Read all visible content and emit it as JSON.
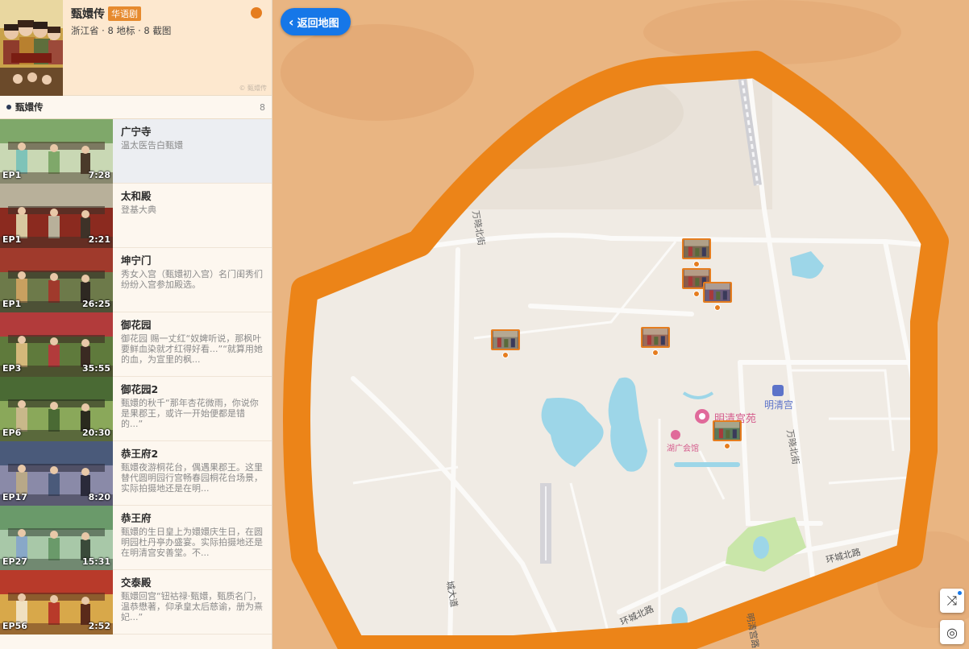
{
  "header": {
    "show_title": "甄嬛传",
    "show_tag": "华语剧",
    "meta": "浙江省 · 8 地标 · 8 截图",
    "copyright": "© 甄嬛传"
  },
  "group": {
    "name": "甄嬛传",
    "count": "8"
  },
  "items": [
    {
      "title": "广宁寺",
      "desc": "温太医告白甄嬛",
      "ep": "EP1",
      "duration": "7:28",
      "active": true
    },
    {
      "title": "太和殿",
      "desc": "登基大典",
      "ep": "EP1",
      "duration": "2:21"
    },
    {
      "title": "坤宁门",
      "desc": "秀女入宫（甄嬛初入宫）名门闺秀们纷纷入宫参加殿选。",
      "ep": "EP1",
      "duration": "26:25"
    },
    {
      "title": "御花园",
      "desc": "御花园 赐一丈红“奴婢听说，那枫叶要鲜血染就才红得好看...”“就算用她的血，为宣里的枫...",
      "ep": "EP3",
      "duration": "35:55"
    },
    {
      "title": "御花园2",
      "desc": "甄嬛的秋千“那年杏花微雨，你说你是果郡王，或许一开始便都是错的...”",
      "ep": "EP6",
      "duration": "20:30"
    },
    {
      "title": "恭王府2",
      "desc": "甄嬛夜游桐花台，偶遇果郡王。这里替代圆明园行宫畅春园桐花台场景，实际拍摄地还是在明...",
      "ep": "EP17",
      "duration": "8:20"
    },
    {
      "title": "恭王府",
      "desc": "甄嬛的生日皇上为嬛嬛庆生日，在圆明园杜丹亭办盛宴。实际拍摄地还是在明清宫安善堂。不...",
      "ep": "EP27",
      "duration": "15:31"
    },
    {
      "title": "交泰殿",
      "desc": "甄嬛回宫“钮祜禄·甄嬛，甄质名门，温恭懋著，仰承皇太后慈谕，册为熹妃...”",
      "ep": "EP56",
      "duration": "2:52"
    }
  ],
  "map": {
    "back_label": "返回地图",
    "labels": {
      "wanxiao_north_1": "万晓北街",
      "wanxiao_north_2": "万晓北街",
      "ring_north": "环城北路",
      "ring_north_2": "环城北路",
      "mingqing_road": "明清宫路",
      "city_avenue": "城大道",
      "mingqing_palace": "明清宫",
      "mingqing_garden": "明清宫苑",
      "huguang_hall": "湖广会馆"
    },
    "colors": {
      "boundary": "#ec8418",
      "land": "#f0ebe4",
      "outside": "#e9b582",
      "water": "#9dd6e8",
      "park": "#c9e6a9",
      "accent": "#1677e8"
    },
    "icons": {
      "shuffle": "shuffle-icon",
      "locate": "locate-icon",
      "metro": "metro-icon",
      "pin": "map-pin-icon"
    }
  }
}
